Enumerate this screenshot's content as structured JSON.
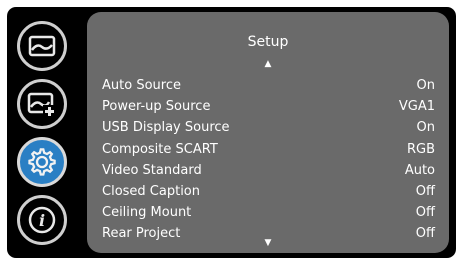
{
  "sidebar": {
    "items": [
      {
        "icon": "picture-icon",
        "active": false
      },
      {
        "icon": "picture-settings-icon",
        "active": false
      },
      {
        "icon": "gear-icon",
        "active": true
      },
      {
        "icon": "info-icon",
        "active": false
      }
    ]
  },
  "menu": {
    "title": "Setup",
    "scroll_up_symbol": "▲",
    "scroll_down_symbol": "▼",
    "items": [
      {
        "label": "Auto Source",
        "value": "On"
      },
      {
        "label": "Power-up Source",
        "value": "VGA1"
      },
      {
        "label": "USB Display Source",
        "value": "On"
      },
      {
        "label": "Composite SCART",
        "value": "RGB"
      },
      {
        "label": "Video Standard",
        "value": "Auto"
      },
      {
        "label": "Closed Caption",
        "value": "Off"
      },
      {
        "label": "Ceiling Mount",
        "value": "Off"
      },
      {
        "label": "Rear Project",
        "value": "Off"
      }
    ]
  },
  "colors": {
    "background": "#000000",
    "panel": "#6a6a6a",
    "active_button": "#2a7fc4",
    "text": "#ffffff"
  }
}
